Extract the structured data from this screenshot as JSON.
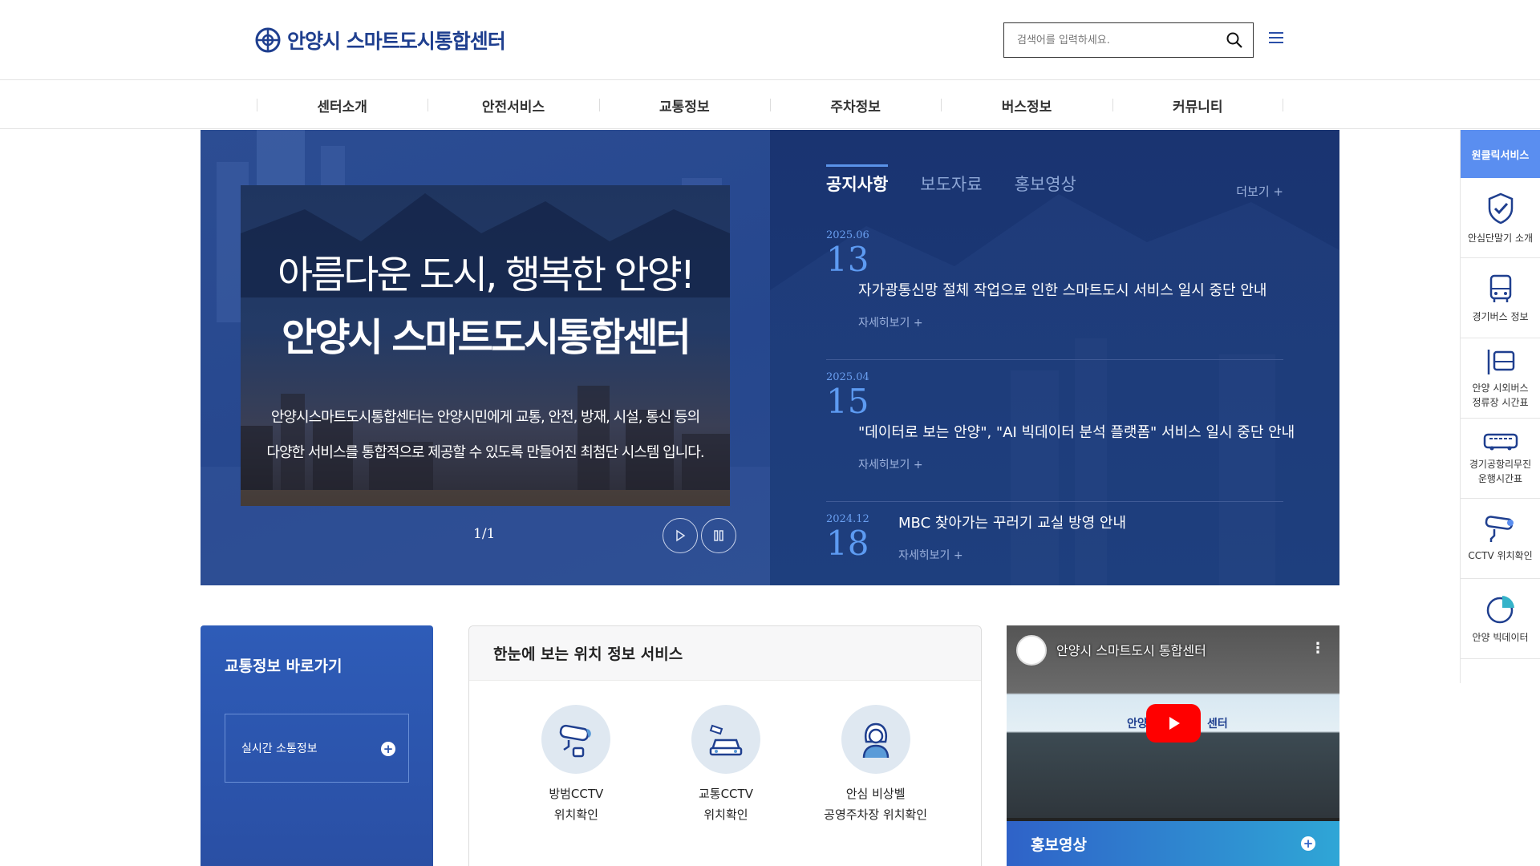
{
  "header": {
    "logo_text": "안양시 스마트도시통합센터",
    "search_placeholder": "검색어를 입력하세요."
  },
  "nav": {
    "items": [
      "센터소개",
      "안전서비스",
      "교통정보",
      "주차정보",
      "버스정보",
      "커뮤니티"
    ]
  },
  "hero": {
    "slide_title_1": "아름다운 도시, 행복한 안양!",
    "slide_title_2": "안양시 스마트도시통합센터",
    "slide_desc_1": "안양시스마트도시통합센터는 안양시민에게 교통, 안전, 방재, 시설, 통신 등의",
    "slide_desc_2": "다양한 서비스를 통합적으로 제공할 수 있도록 만들어진 최첨단 시스템 입니다.",
    "pager": "1/1"
  },
  "notice": {
    "tabs": [
      "공지사항",
      "보도자료",
      "홍보영상"
    ],
    "more": "더보기 +",
    "items": [
      {
        "ym": "2025.06",
        "day": "13",
        "title": "자가광통신망 절체 작업으로 인한 스마트도시 서비스 일시 중단 안내",
        "detail": "자세히보기 +"
      },
      {
        "ym": "2025.04",
        "day": "15",
        "title": "\"데이터로 보는 안양\", \"AI 빅데이터 분석 플랫폼\" 서비스 일시 중단 안내",
        "detail": "자세히보기 +"
      },
      {
        "ym": "2024.12",
        "day": "18",
        "title": "MBC 찾아가는 꾸러기 교실 방영 안내",
        "detail": "자세히보기 +"
      }
    ]
  },
  "quick": {
    "head": "원클릭서비스",
    "items": [
      {
        "l1": "안심단말기 소개",
        "l2": ""
      },
      {
        "l1": "경기버스 정보",
        "l2": ""
      },
      {
        "l1": "안양 시외버스",
        "l2": "정류장 시간표"
      },
      {
        "l1": "경기공항리무진",
        "l2": "운행시간표"
      },
      {
        "l1": "CCTV 위치확인",
        "l2": ""
      },
      {
        "l1": "안양 빅데이터",
        "l2": ""
      }
    ]
  },
  "traffic": {
    "title": "교통정보 바로가기",
    "link": "실시간 소통정보"
  },
  "location": {
    "title": "한눈에 보는 위치 정보 서비스",
    "items": [
      {
        "l1": "방범CCTV",
        "l2": "위치확인"
      },
      {
        "l1": "교통CCTV",
        "l2": "위치확인"
      },
      {
        "l1": "안심 비상벨",
        "l2": "공영주차장 위치확인"
      }
    ]
  },
  "video": {
    "title": "안양시 스마트도시 통합센터",
    "mid_left": "안양",
    "mid_right": "센터",
    "bar": "홍보영상"
  }
}
